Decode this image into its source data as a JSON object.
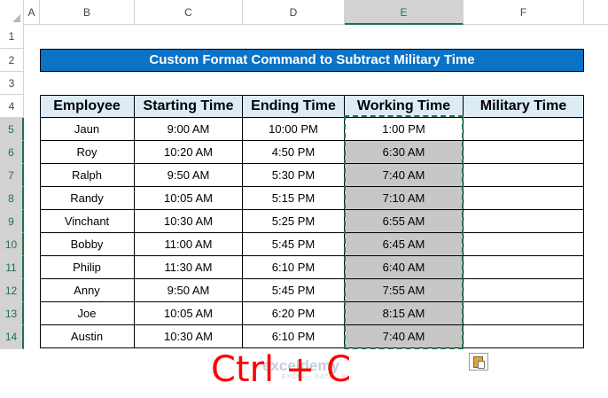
{
  "column_headers": [
    "A",
    "B",
    "C",
    "D",
    "E",
    "F"
  ],
  "row_headers": [
    "1",
    "2",
    "3",
    "4",
    "5",
    "6",
    "7",
    "8",
    "9",
    "10",
    "11",
    "12",
    "13",
    "14"
  ],
  "title": "Custom Format Command to Subtract Military Time",
  "table": {
    "headers": [
      "Employee",
      "Starting Time",
      "Ending Time",
      "Working Time",
      "Military Time"
    ],
    "rows": [
      [
        "Jaun",
        "9:00 AM",
        "10:00 PM",
        "1:00 PM",
        ""
      ],
      [
        "Roy",
        "10:20 AM",
        "4:50 PM",
        "6:30 AM",
        ""
      ],
      [
        "Ralph",
        "9:50 AM",
        "5:30 PM",
        "7:40 AM",
        ""
      ],
      [
        "Randy",
        "10:05 AM",
        "5:15 PM",
        "7:10 AM",
        ""
      ],
      [
        "Vinchant",
        "10:30 AM",
        "5:25 PM",
        "6:55 AM",
        ""
      ],
      [
        "Bobby",
        "11:00 AM",
        "5:45 PM",
        "6:45 AM",
        ""
      ],
      [
        "Philip",
        "11:30 AM",
        "6:10 PM",
        "6:40 AM",
        ""
      ],
      [
        "Anny",
        "9:50 AM",
        "5:45 PM",
        "7:55 AM",
        ""
      ],
      [
        "Joe",
        "10:05 AM",
        "6:20 PM",
        "8:15 AM",
        ""
      ],
      [
        "Austin",
        "10:30 AM",
        "6:10 PM",
        "7:40 AM",
        ""
      ]
    ]
  },
  "shortcut": "Ctrl + C",
  "watermark": {
    "name": "exceldemy",
    "tagline": "EXCEL · DATA · BI"
  },
  "colors": {
    "title_bg": "#0b72c6",
    "header_bg": "#ddebf7",
    "selection_gray": "#c7c7c7",
    "marquee": "#217346",
    "shortcut": "#ff0000"
  },
  "icons": {
    "paste_options": "paste-options-icon"
  }
}
